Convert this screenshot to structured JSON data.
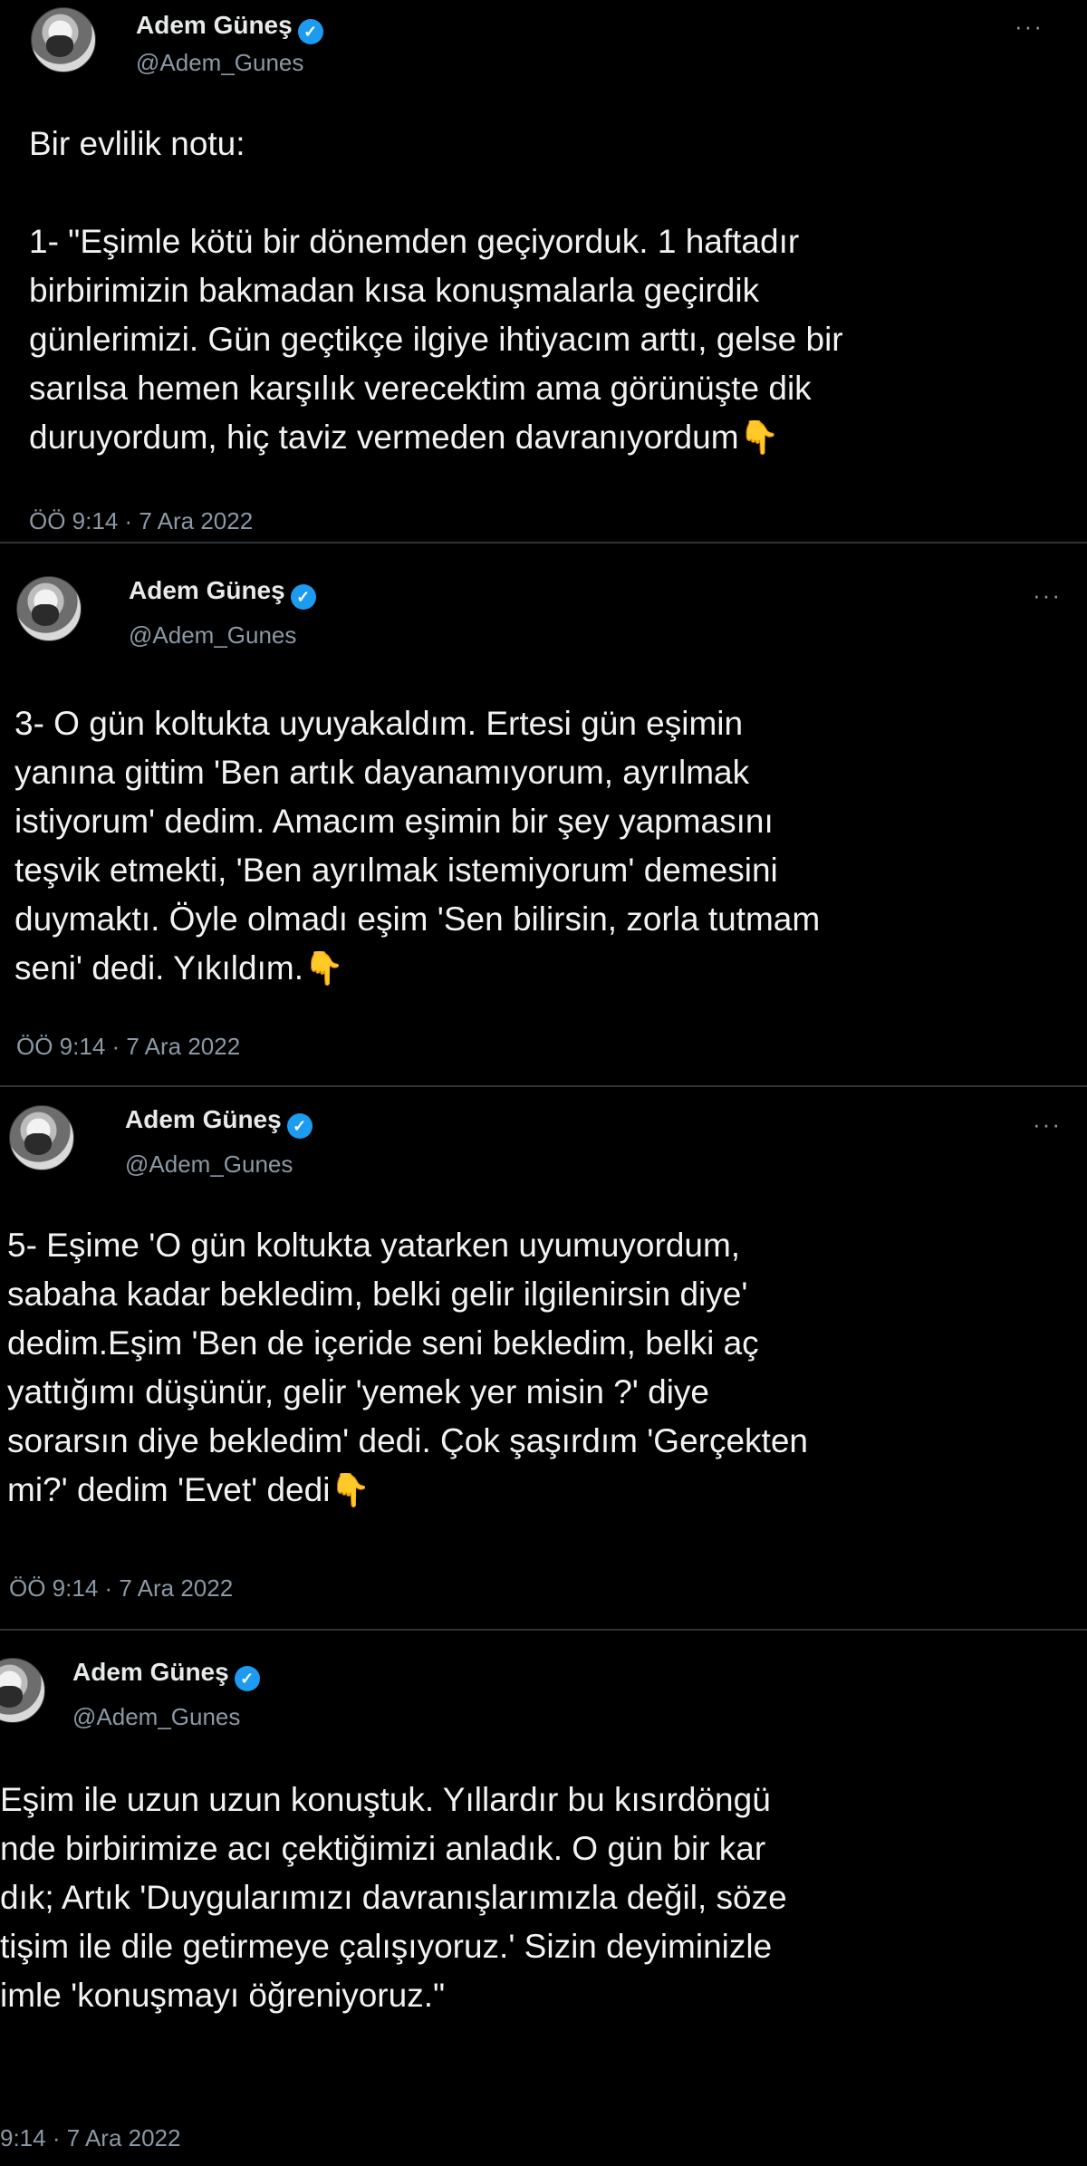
{
  "tweets": [
    {
      "name": "Adem Güneş",
      "handle": "@Adem_Gunes",
      "more": "···",
      "lines": [
        "Bir evlilik notu:",
        "",
        "1- \"Eşimle kötü bir dönemden geçiyorduk. 1 haftadır",
        "birbirimizin bakmadan kısa konuşmalarla geçirdik",
        "günlerimizi. Gün geçtikçe ilgiye ihtiyacım arttı, gelse bir",
        "sarılsa hemen karşılık verecektim ama görünüşte dik",
        "duruyordum, hiç taviz vermeden davranıyordum"
      ],
      "emoji": "👇",
      "time": "ÖÖ 9:14 · 7 Ara 2022"
    },
    {
      "name": "Adem Güneş",
      "handle": "@Adem_Gunes",
      "more": "···",
      "lines": [
        "3- O gün koltukta uyuyakaldım. Ertesi gün eşimin",
        "yanına gittim 'Ben artık dayanamıyorum, ayrılmak",
        "istiyorum' dedim. Amacım eşimin bir şey yapmasını",
        "teşvik etmekti, 'Ben ayrılmak istemiyorum' demesini",
        "duymaktı. Öyle olmadı eşim 'Sen bilirsin, zorla tutmam",
        "seni' dedi. Yıkıldım."
      ],
      "emoji": "👇",
      "time": "ÖÖ 9:14 · 7 Ara 2022"
    },
    {
      "name": "Adem Güneş",
      "handle": "@Adem_Gunes",
      "more": "···",
      "lines": [
        "5- Eşime 'O gün koltukta yatarken uyumuyordum,",
        "sabaha kadar bekledim, belki gelir ilgilenirsin diye'",
        "dedim.Eşim 'Ben de içeride seni bekledim, belki aç",
        "yattığımı düşünür, gelir 'yemek yer misin ?' diye",
        "sorarsın diye bekledim' dedi. Çok şaşırdım 'Gerçekten",
        "mi?' dedim 'Evet' dedi"
      ],
      "emoji": "👇",
      "time": "ÖÖ 9:14 · 7 Ara 2022"
    },
    {
      "name": "Adem Güneş",
      "handle": "@Adem_Gunes",
      "lines": [
        "Eşim ile uzun uzun konuştuk. Yıllardır bu kısırdöngü",
        "nde birbirimize acı çektiğimizi anladık. O gün bir kar",
        "dık; Artık 'Duygularımızı davranışlarımızla değil, söze",
        "tişim ile dile getirmeye çalışıyoruz.' Sizin deyiminizle",
        "imle 'konuşmayı öğreniyoruz.\""
      ],
      "time": "9:14 · 7 Ara 2022"
    }
  ]
}
